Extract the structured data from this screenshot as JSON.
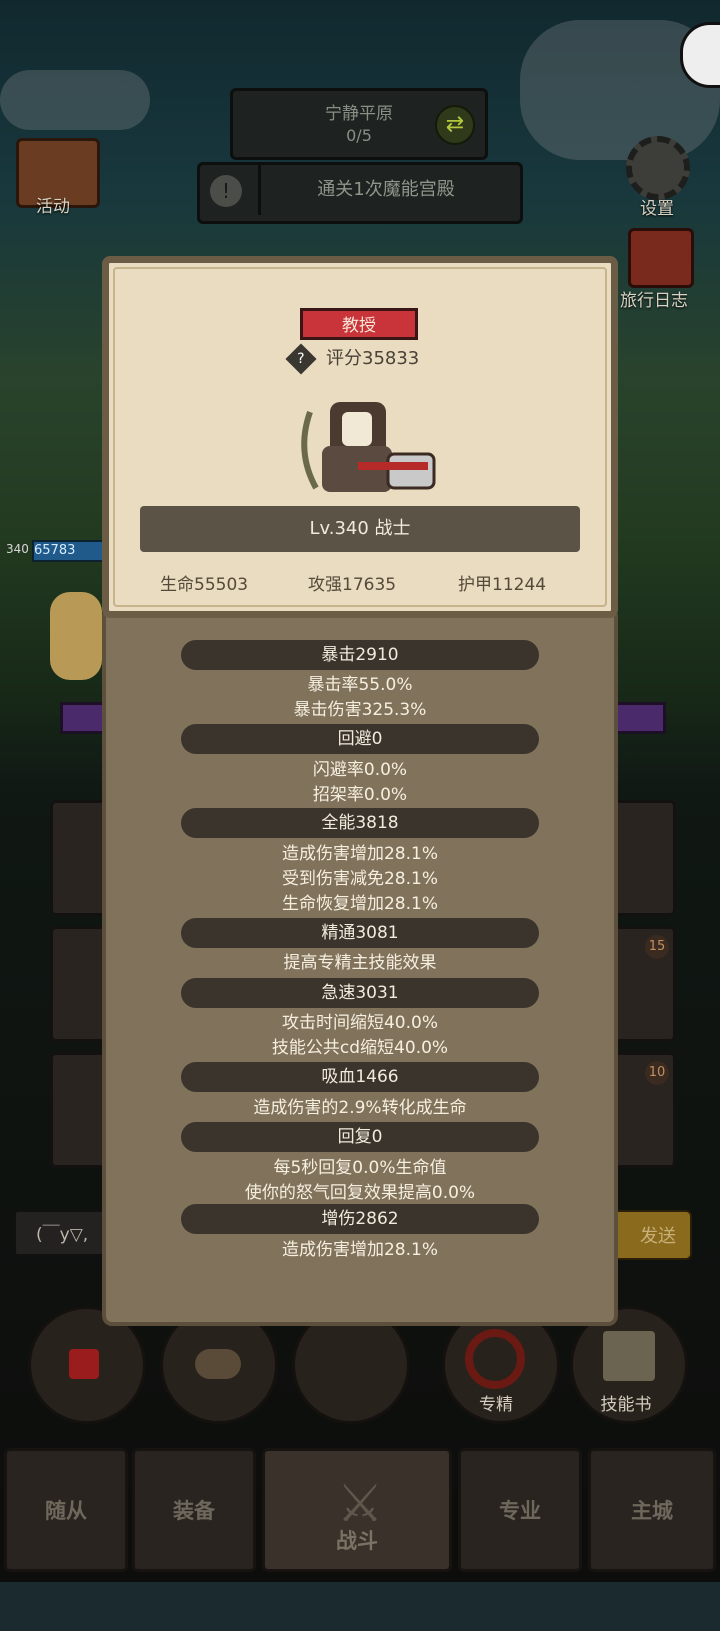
{
  "top": {
    "stage_name": "宁静平原",
    "stage_progress": "0/5",
    "quest_text": "通关1次魔能宫殿",
    "activity_label": "活动",
    "settings_label": "设置",
    "travel_log_label": "旅行日志"
  },
  "hero_strip": {
    "level": "340",
    "hp": "65783"
  },
  "popup": {
    "title_badge": "教授",
    "help_icon": "?",
    "score": "评分35833",
    "level_class": "Lv.340 战士",
    "hp": "生命55503",
    "attack": "攻强17635",
    "armor": "护甲11244",
    "sections": [
      {
        "header": "暴击2910",
        "lines": [
          "暴击率55.0%",
          "暴击伤害325.3%"
        ]
      },
      {
        "header": "回避0",
        "lines": [
          "闪避率0.0%",
          "招架率0.0%"
        ]
      },
      {
        "header": "全能3818",
        "lines": [
          "造成伤害增加28.1%",
          "受到伤害减免28.1%",
          "生命恢复增加28.1%"
        ]
      },
      {
        "header": "精通3081",
        "lines": [
          "提高专精主技能效果"
        ]
      },
      {
        "header": "急速3031",
        "lines": [
          "攻击时间缩短40.0%",
          "技能公共cd缩短40.0%"
        ]
      },
      {
        "header": "吸血1466",
        "lines": [
          "造成伤害的2.9%转化成生命"
        ]
      },
      {
        "header": "回复0",
        "lines": [
          "每5秒回复0.0%生命值",
          "使你的怒气回复效果提高0.0%"
        ]
      },
      {
        "header": "增伤2862",
        "lines": [
          "造成伤害增加28.1%"
        ]
      }
    ]
  },
  "chat": {
    "input_text": "(￣y▽,",
    "send_label": "发送"
  },
  "slots": {
    "badge_15": "15",
    "badge_10": "10"
  },
  "actions": {
    "specialization_label": "专精",
    "skill_book_label": "技能书"
  },
  "tabs": {
    "followers": "随从",
    "equipment": "装备",
    "battle": "战斗",
    "profession": "专业",
    "main_city": "主城"
  },
  "colors": {
    "title_red": "#c9343a",
    "panel_parchment": "#e9dcc0",
    "panel_brown": "#81735b",
    "header_dark": "#3b342c"
  }
}
